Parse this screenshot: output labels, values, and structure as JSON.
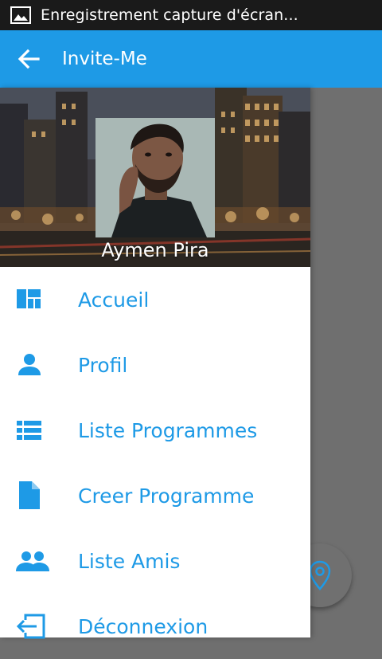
{
  "status_bar": {
    "notification_text": "Enregistrement capture d'écran...",
    "icon": "image-icon"
  },
  "app_bar": {
    "title": "Invite-Me",
    "back_icon": "arrow-back-icon",
    "color": "#1e9ae6"
  },
  "drawer": {
    "user_name": "Aymen Pira",
    "items": [
      {
        "label": "Accueil",
        "icon": "dashboard-icon"
      },
      {
        "label": "Profil",
        "icon": "person-icon"
      },
      {
        "label": "Liste Programmes",
        "icon": "list-icon"
      },
      {
        "label": "Creer Programme",
        "icon": "file-icon"
      },
      {
        "label": "Liste Amis",
        "icon": "people-icon"
      },
      {
        "label": "Déconnexion",
        "icon": "logout-icon"
      }
    ]
  },
  "fab": {
    "icon": "location-pin-icon"
  }
}
